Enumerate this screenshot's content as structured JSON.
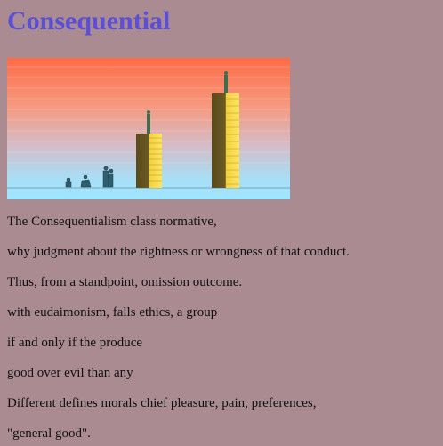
{
  "page": {
    "title": "Consequential",
    "title_color": "#5a4fd6",
    "background": "#a98b91"
  },
  "illustration": {
    "icon": "stacks-of-gold-coins-with-figures-illustration",
    "sky_top": "#ff6b45",
    "sky_bottom": "#9fe6ff",
    "coin_color": "#f3d23a"
  },
  "paragraphs": [
    "The Consequentialism class normative,",
    "why judgment about the rightness or wrongness of that conduct.",
    "Thus, from a standpoint, omission outcome.",
    "with eudaimonism, falls ethics, a group",
    "if and only if the produce",
    "good over evil than any",
    "Different defines morals chief pleasure, pain, preferences,",
    "\"general good\"."
  ]
}
